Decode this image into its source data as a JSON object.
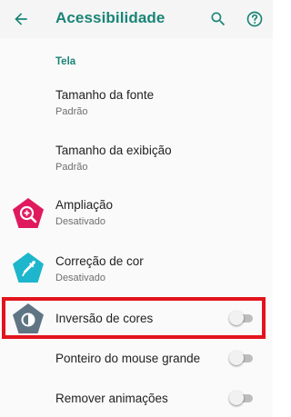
{
  "toolbar": {
    "title": "Acessibilidade",
    "back_icon": "arrow-back-icon",
    "search_icon": "search-icon",
    "help_icon": "help-icon"
  },
  "section": {
    "label": "Tela"
  },
  "items": [
    {
      "title": "Tamanho da fonte",
      "subtitle": "Padrão"
    },
    {
      "title": "Tamanho da exibição",
      "subtitle": "Padrão"
    },
    {
      "title": "Ampliação",
      "subtitle": "Desativado",
      "icon": "magnification-icon",
      "icon_color": "#e0195e"
    },
    {
      "title": "Correção de cor",
      "subtitle": "Desativado",
      "icon": "eyedropper-icon",
      "icon_color": "#1eb6cc"
    },
    {
      "title": "Inversão de cores",
      "toggle": false,
      "icon": "color-inversion-icon",
      "icon_color": "#5f7583"
    },
    {
      "title": "Ponteiro do mouse grande",
      "toggle": false
    },
    {
      "title": "Remover animações",
      "toggle": false
    }
  ],
  "colors": {
    "accent": "#1a8476",
    "highlight": "#e2141d"
  }
}
